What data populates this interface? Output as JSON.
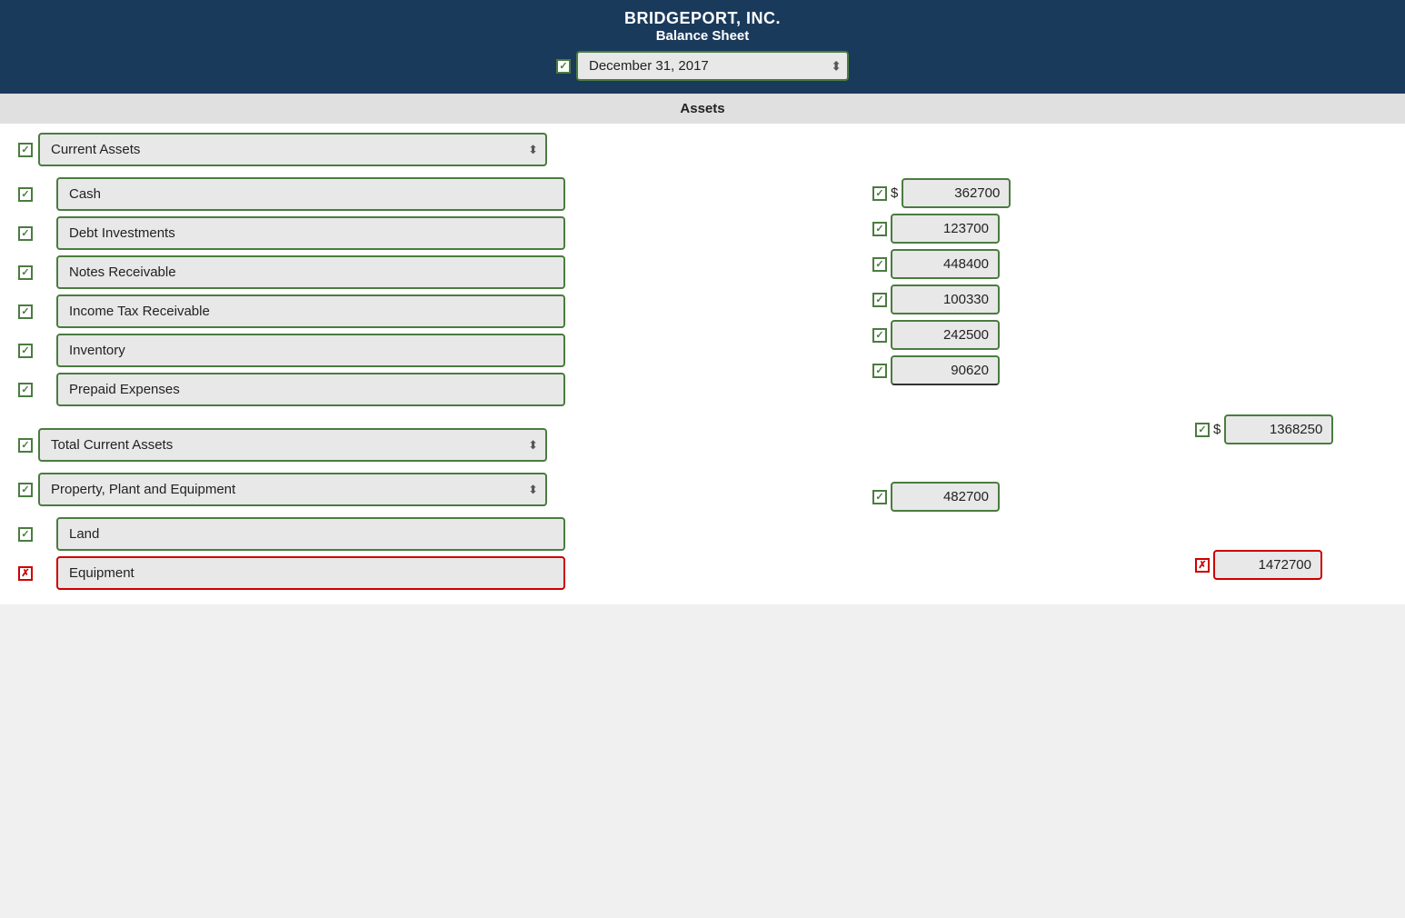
{
  "header": {
    "company": "BRIDGEPORT, INC.",
    "report": "Balance Sheet",
    "date": "December 31, 2017"
  },
  "sections": {
    "assets_label": "Assets"
  },
  "rows": [
    {
      "id": "current-assets",
      "label": "Current Assets",
      "indent": false,
      "arrow": true,
      "checked": true,
      "type": "category"
    },
    {
      "id": "cash",
      "label": "Cash",
      "indent": true,
      "checked": true,
      "type": "item"
    },
    {
      "id": "debt-investments",
      "label": "Debt Investments",
      "indent": true,
      "checked": true,
      "type": "item"
    },
    {
      "id": "notes-receivable",
      "label": "Notes Receivable",
      "indent": true,
      "checked": true,
      "type": "item"
    },
    {
      "id": "income-tax-receivable",
      "label": "Income Tax Receivable",
      "indent": true,
      "checked": true,
      "type": "item"
    },
    {
      "id": "inventory",
      "label": "Inventory",
      "indent": true,
      "checked": true,
      "type": "item"
    },
    {
      "id": "prepaid-expenses",
      "label": "Prepaid Expenses",
      "indent": true,
      "checked": true,
      "type": "item",
      "underline": true
    },
    {
      "id": "total-current-assets",
      "label": "Total Current Assets",
      "indent": false,
      "arrow": true,
      "checked": true,
      "type": "total"
    },
    {
      "id": "ppe",
      "label": "Property, Plant and Equipment",
      "indent": false,
      "arrow": true,
      "checked": true,
      "type": "category"
    },
    {
      "id": "land",
      "label": "Land",
      "indent": true,
      "checked": true,
      "type": "item"
    },
    {
      "id": "equipment",
      "label": "Equipment",
      "indent": true,
      "checked": false,
      "type": "item",
      "error": true
    }
  ],
  "amounts_col1": [
    {
      "id": "cash-amt",
      "value": "362700",
      "checked": true,
      "dollar": true
    },
    {
      "id": "debt-investments-amt",
      "value": "123700",
      "checked": true
    },
    {
      "id": "notes-receivable-amt",
      "value": "448400",
      "checked": true
    },
    {
      "id": "income-tax-receivable-amt",
      "value": "100330",
      "checked": true
    },
    {
      "id": "inventory-amt",
      "value": "242500",
      "checked": true
    },
    {
      "id": "prepaid-expenses-amt",
      "value": "90620",
      "checked": true,
      "underline": true
    },
    {
      "id": "land-amt",
      "value": "482700",
      "checked": true
    }
  ],
  "amounts_col2": [
    {
      "id": "total-current-assets-amt",
      "value": "1368250",
      "checked": true,
      "dollar": true
    },
    {
      "id": "equipment-amt",
      "value": "1472700",
      "checked": false,
      "error": true
    }
  ]
}
